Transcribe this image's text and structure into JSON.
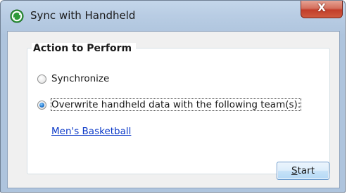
{
  "window": {
    "title": "Sync with Handheld",
    "close_glyph": "X",
    "icon": "sync-icon"
  },
  "group": {
    "title": "Action to Perform",
    "options": [
      {
        "label": "Synchronize",
        "checked": false
      },
      {
        "label": "Overwrite handheld data with the following team(s):",
        "checked": true
      }
    ],
    "team_link": "Men's Basketball"
  },
  "buttons": {
    "start_first": "S",
    "start_rest": "tart"
  }
}
